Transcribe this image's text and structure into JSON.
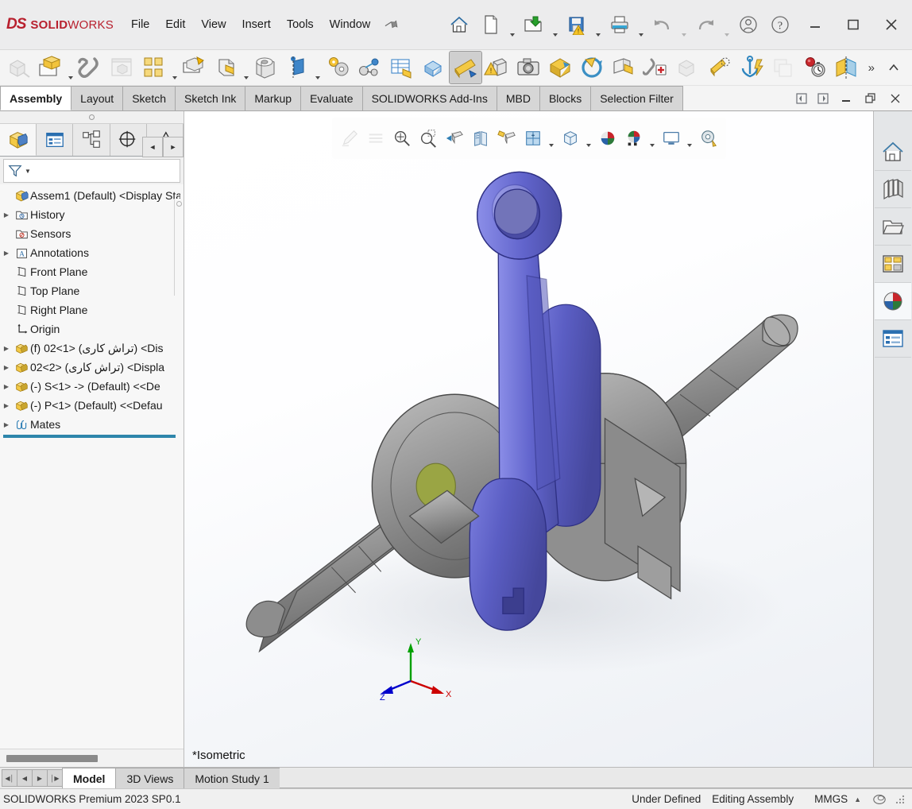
{
  "app": {
    "brand_ds": "DS",
    "brand_name_bold": "SOLID",
    "brand_name_light": "WORKS",
    "brand_color": "#b8202e",
    "accent_color": "#2e86ab"
  },
  "menubar": {
    "items": [
      {
        "label": "File",
        "name": "menu-file"
      },
      {
        "label": "Edit",
        "name": "menu-edit"
      },
      {
        "label": "View",
        "name": "menu-view"
      },
      {
        "label": "Insert",
        "name": "menu-insert"
      },
      {
        "label": "Tools",
        "name": "menu-tools"
      },
      {
        "label": "Window",
        "name": "menu-window"
      }
    ],
    "pin_icon": "pushpin-icon"
  },
  "title_toolbar": {
    "items": [
      {
        "name": "home-icon",
        "label": "Home",
        "caret": false
      },
      {
        "name": "new-document-icon",
        "label": "New",
        "caret": true
      },
      {
        "name": "open-document-icon",
        "label": "Open",
        "caret": true
      },
      {
        "name": "save-warning-icon",
        "label": "Save",
        "caret": true
      },
      {
        "name": "print-icon",
        "label": "Print",
        "caret": true
      },
      {
        "name": "undo-icon",
        "label": "Undo",
        "caret": true,
        "disabled": true
      },
      {
        "name": "redo-icon",
        "label": "Redo",
        "caret": true,
        "disabled": true
      },
      {
        "name": "user-account-icon",
        "label": "Account",
        "caret": false
      },
      {
        "name": "help-icon",
        "label": "Help",
        "caret": false
      }
    ],
    "window_minimize": "minimize-icon",
    "window_maximize": "maximize-icon",
    "window_close": "close-icon"
  },
  "command_manager": {
    "overflow_label": "»",
    "collapse_label": "^",
    "buttons": [
      {
        "name": "edit-component-icon",
        "label": "Edit Component",
        "disabled": true
      },
      {
        "name": "insert-components-icon",
        "label": "Insert Components",
        "caret": true
      },
      {
        "name": "mate-icon",
        "label": "Mate"
      },
      {
        "name": "linear-component-pattern-icon",
        "label": "Linear Component Pattern",
        "disabled": true
      },
      {
        "name": "smart-fasteners-icon",
        "label": "Smart Fasteners",
        "caret": true
      },
      {
        "name": "move-component-icon",
        "label": "Move Component"
      },
      {
        "name": "show-hidden-components-icon",
        "label": "Show Hidden Components",
        "caret": true
      },
      {
        "name": "assembly-features-icon",
        "label": "Assembly Features"
      },
      {
        "name": "reference-geometry-icon",
        "label": "Reference Geometry",
        "caret": true
      },
      {
        "name": "new-motion-study-icon",
        "label": "New Motion Study",
        "caret": true
      },
      {
        "name": "bill-of-materials-icon",
        "label": "Bill of Materials"
      },
      {
        "name": "exploded-view-icon",
        "label": "Exploded View"
      },
      {
        "name": "explode-line-sketch-icon",
        "label": "Explode Line Sketch"
      },
      {
        "name": "instant3d-icon",
        "label": "Instant3D",
        "active": true
      },
      {
        "name": "interference-detection-icon",
        "label": "Interference Detection"
      },
      {
        "name": "take-snapshot-icon",
        "label": "Take Snapshot"
      },
      {
        "name": "update-speedpak-icon",
        "label": "Update SpeedPak"
      },
      {
        "name": "rotate-component-icon",
        "label": "Rotate Component"
      },
      {
        "name": "replace-components-icon",
        "label": "Replace Components"
      },
      {
        "name": "add-mate-reference-icon",
        "label": "Add Mate Reference"
      },
      {
        "name": "hide-show-components-icon",
        "label": "Hide/Show Components",
        "disabled": true
      },
      {
        "name": "assembly-visualization-icon",
        "label": "Assembly Visualization"
      },
      {
        "name": "fix-component-icon",
        "label": "Fix Component"
      },
      {
        "name": "large-assembly-settings-icon",
        "label": "Large Assembly Settings",
        "disabled": true
      },
      {
        "name": "performance-evaluation-icon",
        "label": "Performance Evaluation"
      },
      {
        "name": "section-view-icon",
        "label": "Section View"
      }
    ]
  },
  "ribbon_tabs": {
    "selected": "Assembly",
    "items": [
      {
        "label": "Assembly",
        "name": "tab-assembly"
      },
      {
        "label": "Layout",
        "name": "tab-layout"
      },
      {
        "label": "Sketch",
        "name": "tab-sketch"
      },
      {
        "label": "Sketch Ink",
        "name": "tab-sketch-ink"
      },
      {
        "label": "Markup",
        "name": "tab-markup"
      },
      {
        "label": "Evaluate",
        "name": "tab-evaluate"
      },
      {
        "label": "SOLIDWORKS Add-Ins",
        "name": "tab-solidworks-add-ins"
      },
      {
        "label": "MBD",
        "name": "tab-mbd"
      },
      {
        "label": "Blocks",
        "name": "tab-blocks"
      },
      {
        "label": "Selection Filter",
        "name": "tab-selection-filter"
      }
    ],
    "doc_prev": "previous-document-icon",
    "doc_next": "next-document-icon",
    "doc_minimize": "document-minimize-icon",
    "doc_restore": "document-restore-icon",
    "doc_close": "document-close-icon"
  },
  "left_panel": {
    "tabs": [
      {
        "name": "feature-manager-design-tree-tab",
        "icon": "assembly-tree-icon",
        "selected": true
      },
      {
        "name": "property-manager-tab",
        "icon": "property-manager-icon",
        "selected": false
      },
      {
        "name": "configuration-manager-tab",
        "icon": "configuration-manager-icon",
        "selected": false
      },
      {
        "name": "dimxpert-manager-tab",
        "icon": "dimxpert-manager-icon",
        "selected": false
      },
      {
        "name": "display-manager-tab",
        "icon": "display-manager-icon",
        "selected": false
      }
    ],
    "nav_prev": "◄",
    "nav_next": "►",
    "filter": {
      "icon": "filter-icon",
      "placeholder": "",
      "value": ""
    },
    "tree": [
      {
        "label": "Assem1 (Default) <Display Sta",
        "icon": "assembly-icon",
        "arrow": false,
        "indent": 0,
        "name": "tree-item-assem1"
      },
      {
        "label": "History",
        "icon": "history-folder-icon",
        "arrow": true,
        "indent": 1,
        "name": "tree-item-history"
      },
      {
        "label": "Sensors",
        "icon": "sensors-folder-icon",
        "arrow": false,
        "indent": 1,
        "name": "tree-item-sensors"
      },
      {
        "label": "Annotations",
        "icon": "annotations-icon",
        "arrow": true,
        "indent": 1,
        "name": "tree-item-annotations"
      },
      {
        "label": "Front Plane",
        "icon": "plane-icon",
        "arrow": false,
        "indent": 1,
        "name": "tree-item-front-plane"
      },
      {
        "label": "Top Plane",
        "icon": "plane-icon",
        "arrow": false,
        "indent": 1,
        "name": "tree-item-top-plane"
      },
      {
        "label": "Right Plane",
        "icon": "plane-icon",
        "arrow": false,
        "indent": 1,
        "name": "tree-item-right-plane"
      },
      {
        "label": "Origin",
        "icon": "origin-icon",
        "arrow": false,
        "indent": 1,
        "name": "tree-item-origin"
      },
      {
        "label": "(f) 02<1> (تراش کاری) <Dis",
        "icon": "component-icon",
        "arrow": true,
        "indent": 1,
        "name": "tree-item-component-02-1"
      },
      {
        "label": "02<2> (تراش کاری) <Displa",
        "icon": "component-icon",
        "arrow": true,
        "indent": 1,
        "name": "tree-item-component-02-2"
      },
      {
        "label": "(-) S<1> -> (Default) <<De",
        "icon": "component-icon",
        "arrow": true,
        "indent": 1,
        "name": "tree-item-component-s-1"
      },
      {
        "label": "(-) P<1> (Default) <<Defau",
        "icon": "component-icon",
        "arrow": true,
        "indent": 1,
        "name": "tree-item-component-p-1"
      },
      {
        "label": "Mates",
        "icon": "mates-icon",
        "arrow": true,
        "indent": 1,
        "name": "tree-item-mates"
      }
    ]
  },
  "viewport": {
    "view_label": "*Isometric",
    "triad": {
      "x_label": "X",
      "y_label": "Y",
      "z_label": "Z",
      "x_color": "#cc0000",
      "y_color": "#00a000",
      "z_color": "#0000cc"
    },
    "model": {
      "connecting_rod_color": "#6366c8",
      "crankshaft_color": "#8e8e8e",
      "highlight_face_color": "#9aa544"
    },
    "heads_up_toolbar": [
      {
        "name": "sketch-pencil-icon",
        "label": "Edit Appearance",
        "disabled": true,
        "caret": false
      },
      {
        "name": "zoom-to-area-lines-icon",
        "label": "Previous View",
        "disabled": true,
        "caret": false
      },
      {
        "name": "zoom-to-fit-icon",
        "label": "Zoom to Fit",
        "caret": false
      },
      {
        "name": "zoom-to-area-icon",
        "label": "Zoom to Area",
        "caret": false
      },
      {
        "name": "section-view-icon",
        "label": "Section View",
        "caret": false
      },
      {
        "name": "view-orientation-icon",
        "label": "View Orientation",
        "caret": false
      },
      {
        "name": "hide-show-annotations-icon",
        "label": "View Settings",
        "caret": false
      },
      {
        "name": "display-style-icon",
        "label": "Display Style",
        "caret": true
      },
      {
        "name": "hide-show-items-icon",
        "label": "Hide/Show Items",
        "caret": true
      },
      {
        "name": "edit-appearance-ball-icon",
        "label": "Edit Appearance",
        "caret": true
      },
      {
        "name": "apply-scene-icon",
        "label": "Apply Scene",
        "caret": false
      },
      {
        "name": "view-setting-scene-icon",
        "label": "Scene Settings",
        "caret": true
      },
      {
        "name": "view-display-icon",
        "label": "View Display",
        "caret": true
      },
      {
        "name": "measure-icon",
        "label": "Measure",
        "caret": false
      }
    ]
  },
  "task_pane": {
    "items": [
      {
        "name": "task-pane-solidworks-resources",
        "icon": "home-resources-icon",
        "selected": false
      },
      {
        "name": "task-pane-design-library",
        "icon": "design-library-icon",
        "selected": false
      },
      {
        "name": "task-pane-file-explorer",
        "icon": "file-explorer-icon",
        "selected": false
      },
      {
        "name": "task-pane-view-palette",
        "icon": "view-palette-icon",
        "selected": false
      },
      {
        "name": "task-pane-appearances-scenes",
        "icon": "appearances-scenes-icon",
        "selected": true
      },
      {
        "name": "task-pane-custom-properties",
        "icon": "custom-properties-icon",
        "selected": false
      }
    ]
  },
  "bottom_tabs": {
    "nav": [
      "◀│",
      "◀",
      "▶",
      "│▶"
    ],
    "selected": "Model",
    "items": [
      {
        "label": "Model",
        "name": "bottom-tab-model"
      },
      {
        "label": "3D Views",
        "name": "bottom-tab-3d-views"
      },
      {
        "label": "Motion Study 1",
        "name": "bottom-tab-motion-study-1"
      }
    ]
  },
  "status_bar": {
    "version": "SOLIDWORKS Premium 2023 SP0.1",
    "sketch_status": "Under Defined",
    "edit_mode": "Editing Assembly",
    "units": "MMGS",
    "units_caret": "▲",
    "overlay_icon": "overlay-icon",
    "resize_grip": "resize-grip-icon"
  }
}
